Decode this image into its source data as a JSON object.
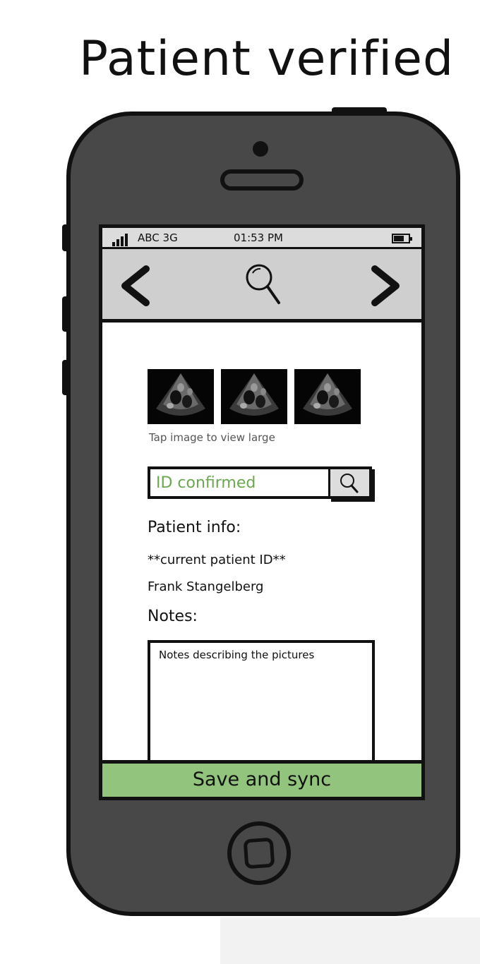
{
  "title": "Patient verified",
  "status_bar": {
    "carrier": "ABC 3G",
    "time": "01:53 PM"
  },
  "nav": {
    "back_icon": "chevron-left-icon",
    "search_icon": "magnifier-icon",
    "forward_icon": "chevron-right-icon"
  },
  "images": {
    "thumbnails": [
      "ultrasound-thumbnail",
      "ultrasound-thumbnail",
      "ultrasound-thumbnail"
    ],
    "hint": "Tap image to view large"
  },
  "id_search": {
    "value": "ID confirmed",
    "button_icon": "magnifier-icon"
  },
  "patient": {
    "heading": "Patient info:",
    "id_line": "**current patient ID**",
    "name": "Frank Stangelberg"
  },
  "notes": {
    "heading": "Notes:",
    "value": "Notes describing the pictures"
  },
  "save_button": "Save and sync",
  "colors": {
    "phone_body": "#484848",
    "nav_bar": "#cfcfcf",
    "confirmed_text": "#6aa84f",
    "save_button": "#93c47d"
  }
}
